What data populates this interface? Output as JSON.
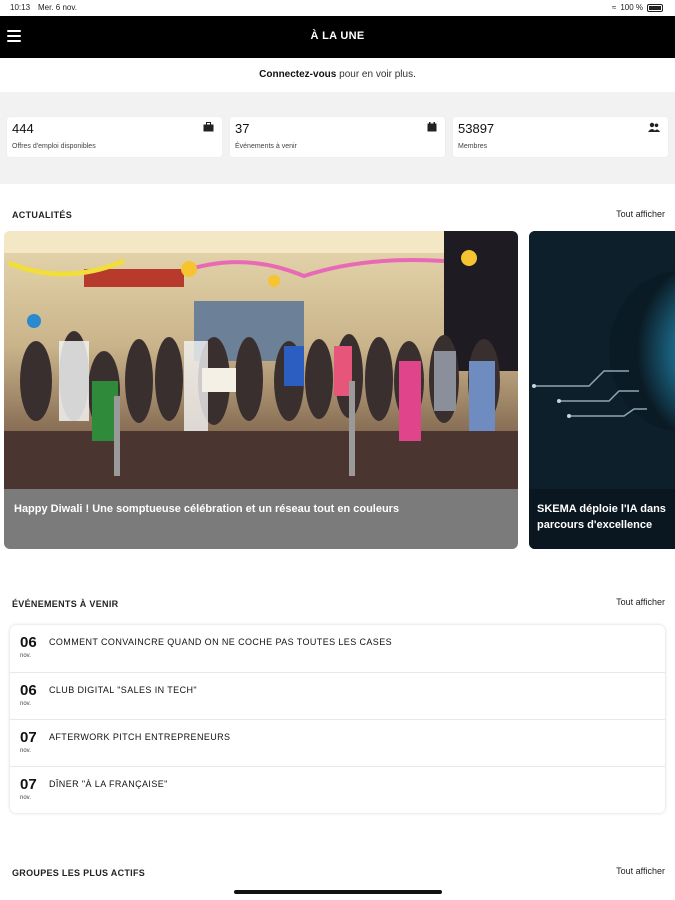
{
  "status_bar": {
    "time": "10:13",
    "date": "Mer. 6 nov.",
    "battery": "100 %"
  },
  "header": {
    "title": "À LA UNE"
  },
  "connect": {
    "link": "Connectez-vous",
    "rest": " pour en voir plus."
  },
  "stats": [
    {
      "value": "444",
      "label": "Offres d'emploi disponibles",
      "icon": "briefcase-icon"
    },
    {
      "value": "37",
      "label": "Événements à venir",
      "icon": "calendar-icon"
    },
    {
      "value": "53897",
      "label": "Membres",
      "icon": "members-icon"
    }
  ],
  "news": {
    "title": "ACTUALITÉS",
    "see_all": "Tout afficher",
    "items": [
      {
        "caption": "Happy Diwali ! Une somptueuse célébration et un réseau tout en couleurs"
      },
      {
        "caption": "SKEMA déploie l'IA dans parcours d'excellence"
      }
    ]
  },
  "events": {
    "title": "ÉVÉNEMENTS À VENIR",
    "see_all": "Tout afficher",
    "items": [
      {
        "day": "06",
        "month": "nov.",
        "name": "COMMENT CONVAINCRE QUAND ON NE COCHE PAS TOUTES LES CASES"
      },
      {
        "day": "06",
        "month": "nov.",
        "name": "CLUB DIGITAL \"SALES IN TECH\""
      },
      {
        "day": "07",
        "month": "nov.",
        "name": "AFTERWORK PITCH ENTREPRENEURS"
      },
      {
        "day": "07",
        "month": "nov.",
        "name": "DÎNER \"À LA FRANÇAISE\""
      }
    ]
  },
  "groups": {
    "title": "GROUPES LES PLUS ACTIFS",
    "see_all": "Tout afficher"
  }
}
